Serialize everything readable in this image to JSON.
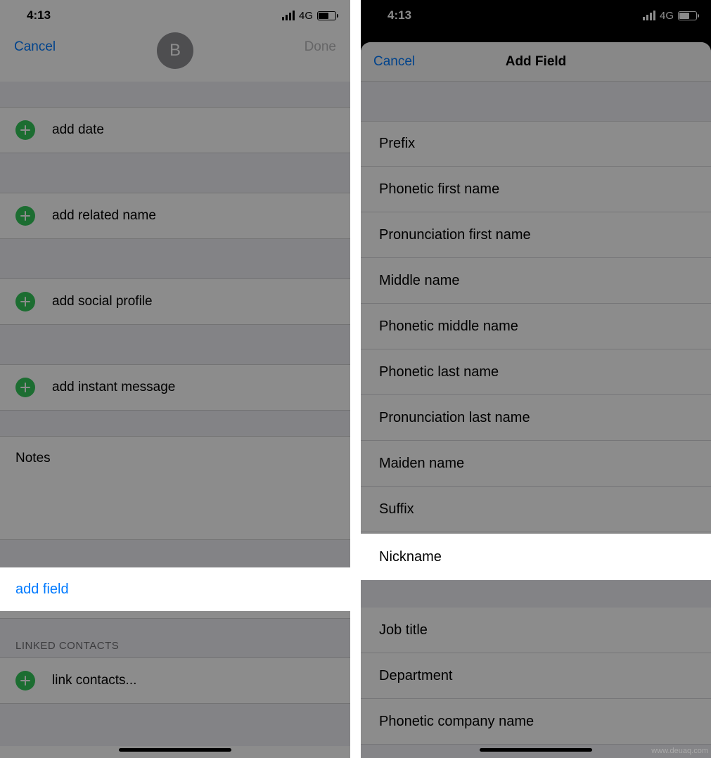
{
  "status": {
    "time": "4:13",
    "network": "4G"
  },
  "left": {
    "nav": {
      "cancel": "Cancel",
      "done": "Done",
      "avatar_initial": "B"
    },
    "rows": {
      "add_date": "add date",
      "add_related_name": "add related name",
      "add_social_profile": "add social profile",
      "add_instant_message": "add instant message",
      "notes": "Notes",
      "add_field": "add field",
      "linked_contacts_header": "LINKED CONTACTS",
      "link_contacts": "link contacts..."
    }
  },
  "right": {
    "sheet": {
      "cancel": "Cancel",
      "title": "Add Field",
      "fields": {
        "prefix": "Prefix",
        "phonetic_first_name": "Phonetic first name",
        "pronunciation_first_name": "Pronunciation first name",
        "middle_name": "Middle name",
        "phonetic_middle_name": "Phonetic middle name",
        "phonetic_last_name": "Phonetic last name",
        "pronunciation_last_name": "Pronunciation last name",
        "maiden_name": "Maiden name",
        "suffix": "Suffix",
        "nickname": "Nickname",
        "job_title": "Job title",
        "department": "Department",
        "phonetic_company_name": "Phonetic company name"
      }
    }
  },
  "watermark": "www.deuaq.com"
}
